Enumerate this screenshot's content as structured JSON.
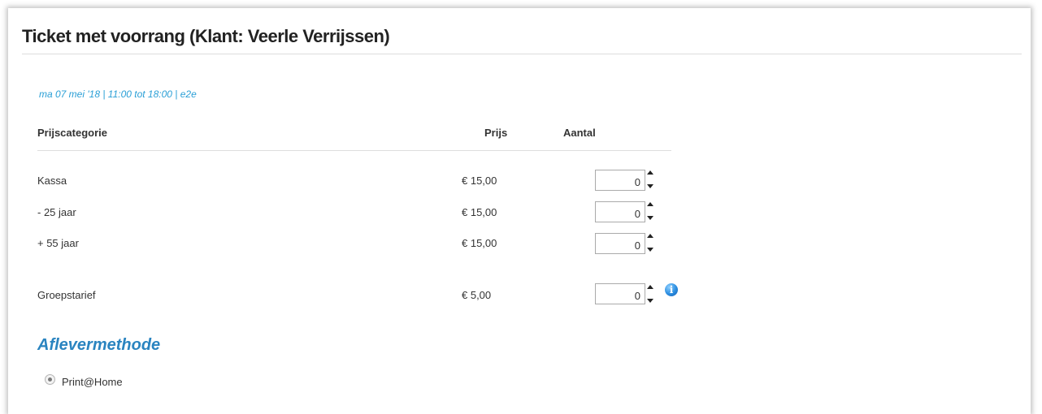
{
  "page": {
    "title": "Ticket met voorrang (Klant: Veerle Verrijssen)",
    "event_info": "ma 07 mei '18 | 11:00 tot 18:00 | e2e"
  },
  "table": {
    "headers": {
      "category": "Prijscategorie",
      "price": "Prijs",
      "quantity": "Aantal"
    },
    "rows": [
      {
        "label": "Kassa",
        "price": "€ 15,00",
        "quantity": "0"
      },
      {
        "label": "- 25 jaar",
        "price": "€ 15,00",
        "quantity": "0"
      },
      {
        "label": "+ 55 jaar",
        "price": "€ 15,00",
        "quantity": "0"
      },
      {
        "label": "Groepstarief",
        "price": "€ 5,00",
        "quantity": "0",
        "info_icon": "info-icon"
      }
    ]
  },
  "delivery": {
    "title": "Aflevermethode",
    "options": [
      {
        "label": "Print@Home",
        "selected": true
      }
    ]
  },
  "colors": {
    "accent": "#2a9fd6",
    "section_title": "#2a84c0"
  }
}
